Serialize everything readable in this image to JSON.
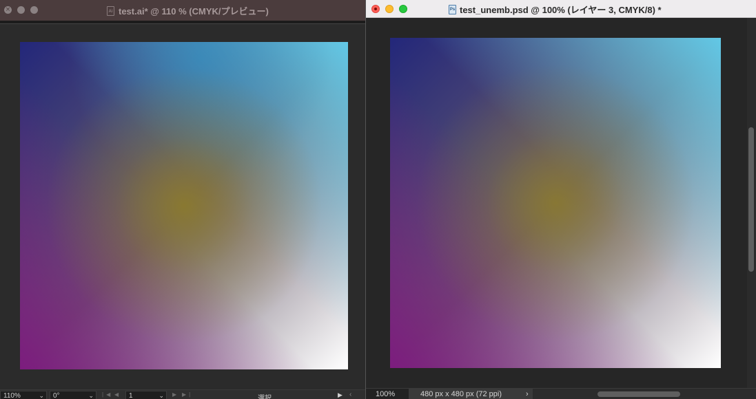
{
  "left_window": {
    "title": "test.ai* @ 110 % (CMYK/プレビュー)",
    "doc_icon": "Ai",
    "status": {
      "zoom": "110%",
      "rotation": "0°",
      "artboard": "1",
      "mode": "選択"
    }
  },
  "right_window": {
    "title": "test_unemb.psd @ 100% (レイヤー 3, CMYK/8) *",
    "doc_icon": "Ps",
    "status": {
      "zoom": "100%",
      "doc_info": "480 px x 480 px (72 ppi)"
    }
  },
  "icons": {
    "close_dim": "close-icon",
    "chevron_down": "chevron-down-icon",
    "nav_first": "first-artboard-icon",
    "nav_prev": "previous-artboard-icon",
    "nav_next": "next-artboard-icon",
    "nav_last": "last-artboard-icon",
    "play": "play-icon",
    "chevron_right": "chevron-right-icon"
  },
  "colors": {
    "ai_titlebar": "#4b3c3d",
    "ps_titlebar": "#eeecee",
    "gradient_top_left": "#23277a",
    "gradient_top_right": "#62c8e6",
    "gradient_bottom_left": "#7c1c7e",
    "gradient_bottom_right": "#ffffff",
    "gradient_center": "#8b7a2e"
  }
}
